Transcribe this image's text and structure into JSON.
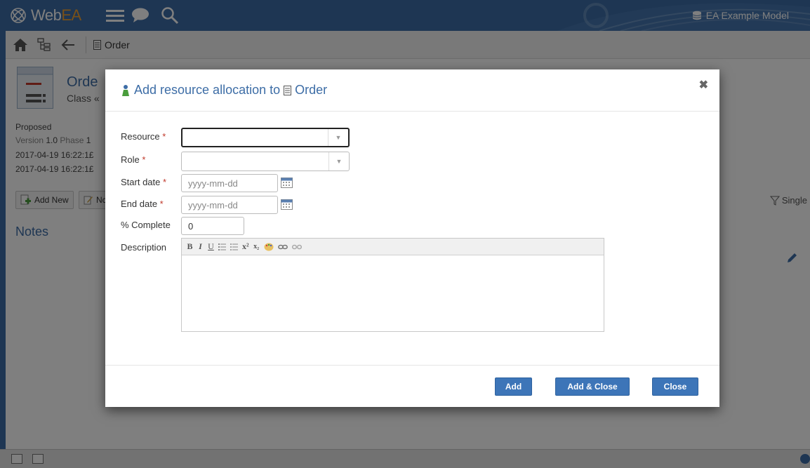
{
  "app": {
    "logo_prefix": "Web",
    "logo_suffix": "EA",
    "model_name": "EA Example Model",
    "icons": [
      "logo-icon",
      "menu-icon",
      "chat-icon",
      "search-icon",
      "database-icon"
    ]
  },
  "nav": {
    "breadcrumb": "Order",
    "icons": [
      "home-icon",
      "tree-icon",
      "back-arrow-icon",
      "class-icon"
    ]
  },
  "background": {
    "element_title": "Orde",
    "element_type": "Class «",
    "status": "Proposed",
    "version_label": "Version",
    "version_value": "1.0",
    "phase_label": "Phase",
    "phase_value": "1",
    "created": "2017-04-19 16:22:1£",
    "modified": "2017-04-19 16:22:1£",
    "add_new_label": "Add New",
    "notes_button_label": "Nc",
    "notes_heading": "Notes",
    "single_label": "Single"
  },
  "modal": {
    "title_prefix": "Add resource allocation to",
    "title_element": "Order",
    "close_symbol": "✖",
    "fields": {
      "resource_label": "Resource",
      "role_label": "Role",
      "start_label": "Start date",
      "end_label": "End date",
      "complete_label": "% Complete",
      "description_label": "Description",
      "required_marker": "*",
      "start_placeholder": "yyyy-mm-dd",
      "end_placeholder": "yyyy-mm-dd",
      "complete_value": "0"
    },
    "toolbar": {
      "bold": "B",
      "italic": "I",
      "underline": "U",
      "superscript": "x²",
      "subscript": "x₂"
    },
    "buttons": {
      "add": "Add",
      "add_close": "Add & Close",
      "close": "Close"
    }
  },
  "colors": {
    "brand_blue": "#3d6da6",
    "button_blue": "#3d75b8",
    "required_red": "#c0392b",
    "logo_orange": "#f0a030"
  }
}
